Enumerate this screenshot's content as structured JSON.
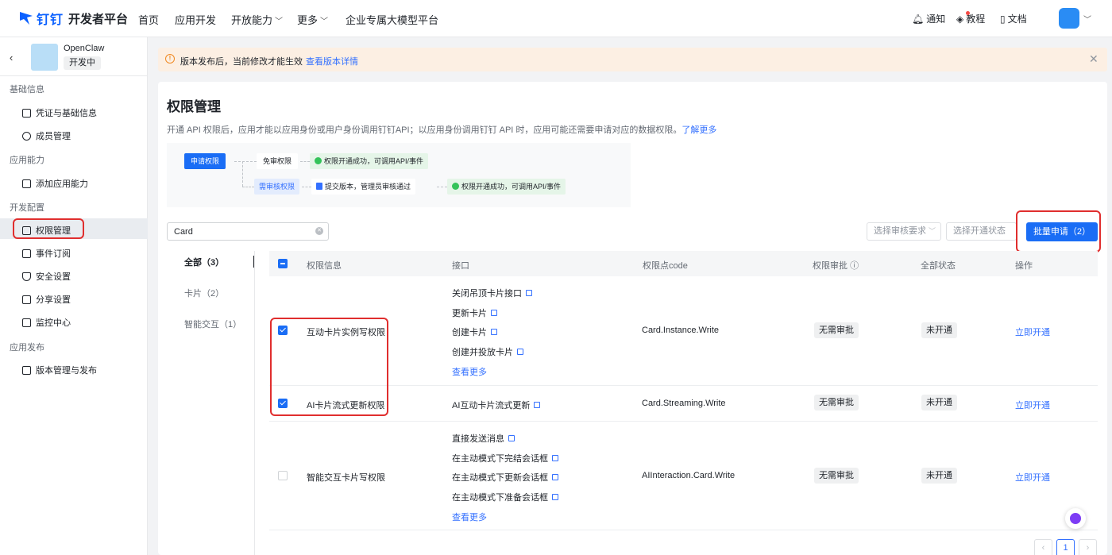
{
  "brand": {
    "logo_text": "钉钉",
    "subtitle": "开发者平台"
  },
  "topnav": {
    "items": [
      "首页",
      "应用开发",
      "开放能力",
      "更多",
      "企业专属大模型平台"
    ],
    "right": [
      "通知",
      "教程",
      "文档"
    ]
  },
  "sidebar": {
    "app_name": "OpenClaw",
    "app_status": "开发中",
    "sections": [
      "基础信息",
      "应用能力",
      "开发配置",
      "应用发布"
    ],
    "items": [
      "凭证与基础信息",
      "成员管理",
      "添加应用能力",
      "权限管理",
      "事件订阅",
      "安全设置",
      "分享设置",
      "监控中心",
      "版本管理与发布"
    ]
  },
  "banner": {
    "text": "版本发布后，当前修改才能生效",
    "link": "查看版本详情"
  },
  "page": {
    "title": "权限管理",
    "desc": "开通 API 权限后，应用才能以应用身份或用户身份调用钉钉API；以应用身份调用钉钉 API 时，应用可能还需要申请对应的数据权限。",
    "learn_more": "了解更多"
  },
  "flow": {
    "apply": "申请权限",
    "free": "免审权限",
    "ok": "权限开通成功，可调用API/事件",
    "need_review": "需审核权限",
    "submit": "提交版本，管理员审核通过"
  },
  "filters": {
    "search_value": "Card",
    "review_placeholder": "选择审核要求",
    "status_placeholder": "选择开通状态",
    "batch_button": "批量申请（2）"
  },
  "left_tabs": [
    "全部（3）",
    "卡片（2）",
    "智能交互（1）"
  ],
  "table": {
    "headers": [
      "权限信息",
      "接口",
      "权限点code",
      "权限审批",
      "全部状态",
      "操作"
    ],
    "rows": [
      {
        "name": "互动卡片实例写权限",
        "apis": [
          "关闭吊顶卡片接口",
          "更新卡片",
          "创建卡片",
          "创建并投放卡片"
        ],
        "more": "查看更多",
        "code": "Card.Instance.Write",
        "approval": "无需审批",
        "status": "未开通",
        "action": "立即开通",
        "checked": true
      },
      {
        "name": "AI卡片流式更新权限",
        "apis": [
          "AI互动卡片流式更新"
        ],
        "code": "Card.Streaming.Write",
        "approval": "无需审批",
        "status": "未开通",
        "action": "立即开通",
        "checked": true
      },
      {
        "name": "智能交互卡片写权限",
        "apis": [
          "直接发送消息",
          "在主动模式下完结会话框",
          "在主动模式下更新会话框",
          "在主动模式下准备会话框"
        ],
        "more": "查看更多",
        "code": "AIInteraction.Card.Write",
        "approval": "无需审批",
        "status": "未开通",
        "action": "立即开通",
        "checked": false
      }
    ]
  },
  "pagination": {
    "current": "1"
  },
  "colors": {
    "primary": "#1a6df5",
    "link": "#3370ff",
    "highlight": "#e02e2e"
  }
}
